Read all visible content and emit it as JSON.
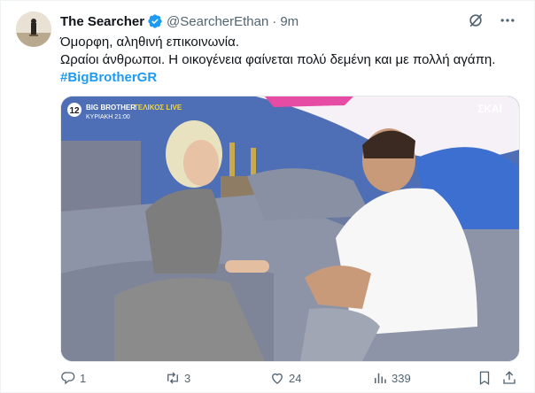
{
  "tweet": {
    "author_name": "The Searcher",
    "handle": "@SearcherEthan",
    "separator": "·",
    "time": "9m",
    "lines": [
      "Όμορφη, αληθινή επικοινωνία.",
      "Ωραίοι άνθρωποι. Η οικογένεια φαίνεται πολύ δεμένη και με πολλή αγάπη."
    ],
    "hashtag": "#BigBrotherGR"
  },
  "media": {
    "channel_number": "12",
    "show_title": "BIG BROTHER",
    "show_subtitle": "ΤΕΛΙΚΟΣ LIVE",
    "schedule": "ΚΥΡΙΑΚΗ 21:00",
    "network_logo": "ΣΚΑΪ"
  },
  "actions": {
    "reply_count": "1",
    "retweet_count": "3",
    "like_count": "24",
    "views_count": "339"
  },
  "icons": {
    "verified": "verified-badge-icon",
    "grok": "grok-icon",
    "more": "more-icon",
    "reply": "reply-icon",
    "retweet": "retweet-icon",
    "like": "heart-icon",
    "views": "views-icon",
    "bookmark": "bookmark-icon",
    "share": "share-icon"
  },
  "colors": {
    "accent": "#1d9bf0",
    "text": "#0f1419",
    "muted": "#536471"
  }
}
